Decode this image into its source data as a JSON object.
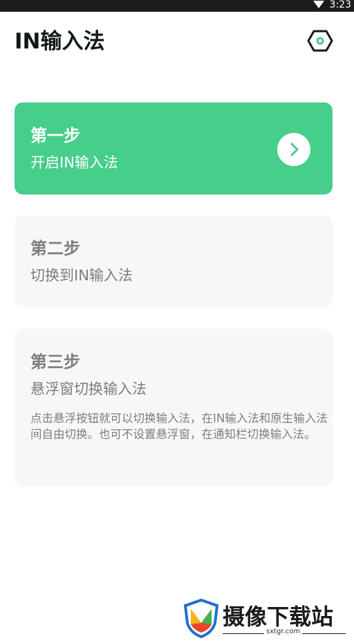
{
  "status_bar": {
    "time": "3:23"
  },
  "header": {
    "title": "IN输入法",
    "settings_icon": "gear-icon"
  },
  "colors": {
    "accent": "#46ce8b",
    "card_gray": "#f7f7f7",
    "text_gray": "#7b7f7c",
    "title": "#111a14"
  },
  "steps": [
    {
      "step": "第一步",
      "desc": "开启IN输入法",
      "state": "active",
      "action_icon": "chevron-right-icon"
    },
    {
      "step": "第二步",
      "desc": "切换到IN输入法",
      "state": "inactive"
    },
    {
      "step": "第三步",
      "desc": "悬浮窗切换输入法",
      "state": "inactive",
      "note": "点击悬浮按钮就可以切换输入法，在IN输入法和原生输入法间自由切换。也可不设置悬浮窗，在通知栏切换输入法。"
    }
  ],
  "watermark": {
    "name": "摄像下载站",
    "url": "sxtgr.com"
  }
}
